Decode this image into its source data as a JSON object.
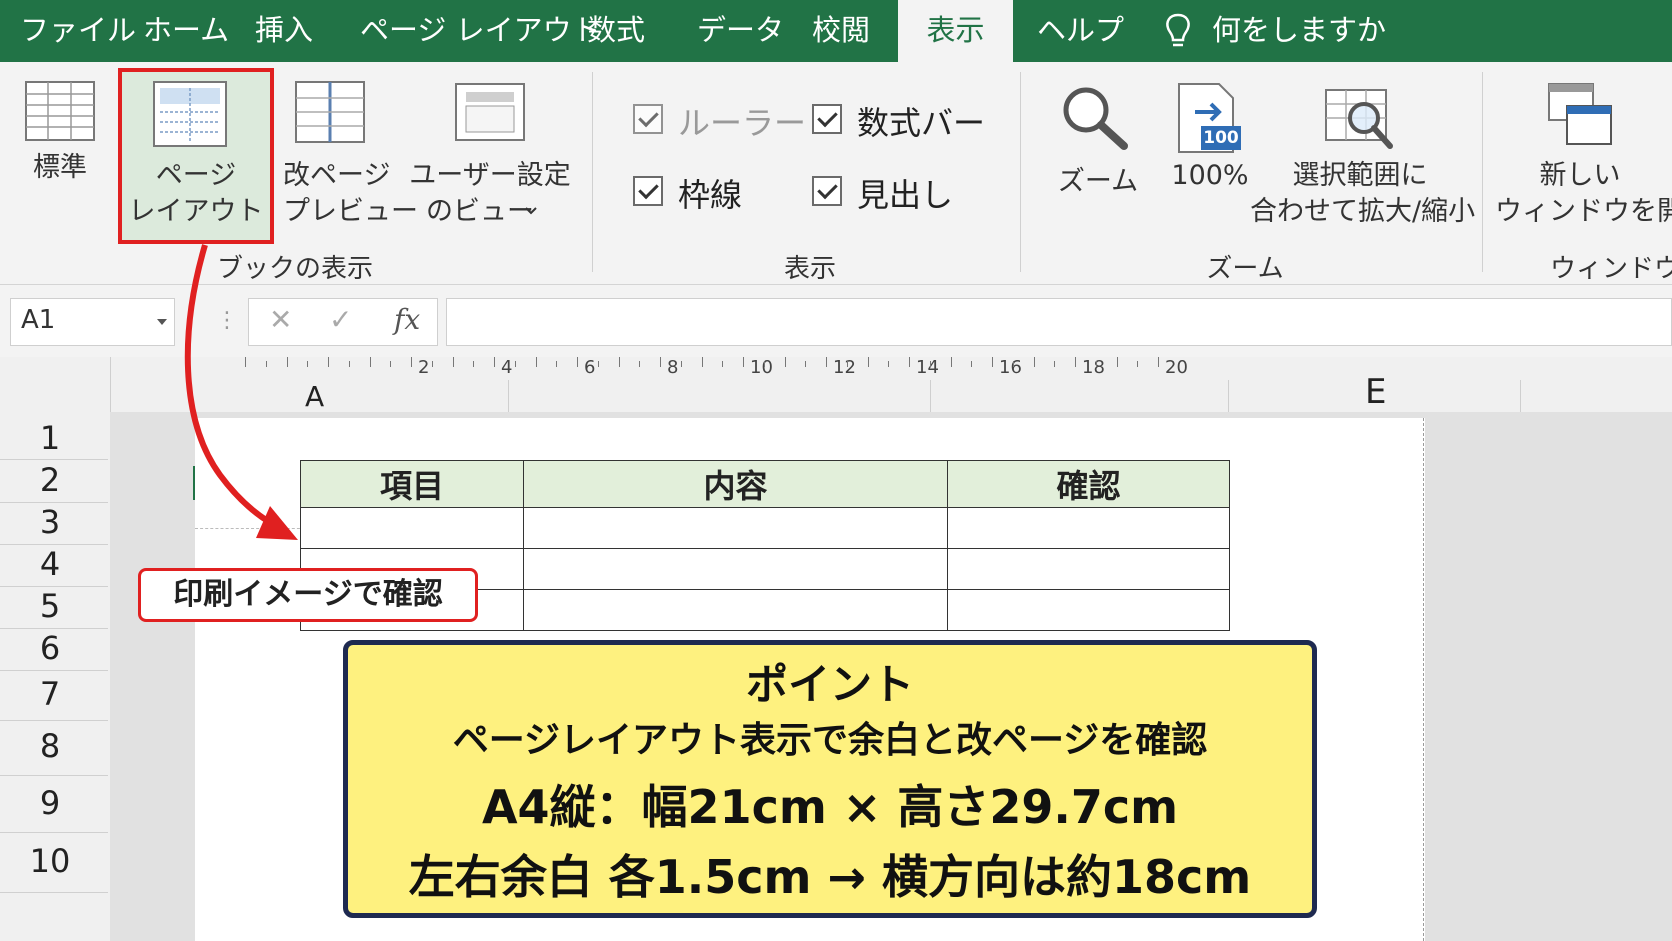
{
  "tabs": [
    "ファイル",
    "ホーム",
    "挿入",
    "ページ レイアウト",
    "数式",
    "データ",
    "校閲",
    "表示",
    "ヘルプ"
  ],
  "tell_me": "何をしますか",
  "ribbon": {
    "view_group": {
      "normal": "標準",
      "page_layout_1": "ページ",
      "page_layout_2": "レイアウト",
      "page_break_1": "改ページ",
      "page_break_2": "プレビュー",
      "custom_1": "ユーザー設定",
      "custom_2": "のビュー",
      "label": "ブックの表示"
    },
    "show_group": {
      "ruler": "ルーラー",
      "formula_bar": "数式バー",
      "gridlines": "枠線",
      "headings": "見出し",
      "label": "表示"
    },
    "zoom_group": {
      "zoom": "ズーム",
      "hundred": "100%",
      "hundred_badge": "100",
      "fit_1": "選択範囲に",
      "fit_2": "合わせて拡大/縮小",
      "label": "ズーム"
    },
    "window_group": {
      "new_1": "新しい",
      "new_2": "ウィンドウを開く",
      "label": "ウィンドウ"
    }
  },
  "name_box": "A1",
  "fx": "fx",
  "ruler_ticks": [
    "2",
    "4",
    "6",
    "8",
    "10",
    "12",
    "14",
    "16",
    "18",
    "20"
  ],
  "col_a": "A",
  "col_e": "E",
  "rows": [
    "1",
    "2",
    "3",
    "4",
    "5",
    "6",
    "7",
    "8",
    "9",
    "10"
  ],
  "table": {
    "headers": [
      "項目",
      "内容",
      "確認"
    ]
  },
  "callout": "印刷イメージで確認",
  "point": {
    "title": "ポイント",
    "line1": "ページレイアウト表示で余白と改ページを確認",
    "line2": "A4縦：幅21cm × 高さ29.7cm",
    "line3": "左右余白 各1.5cm → 横方向は約18cm"
  },
  "colors": {
    "excel_green": "#217346",
    "highlight_red": "#e02020",
    "header_fill": "#e2efda",
    "point_fill": "#fef17f",
    "point_border": "#1e2a50"
  }
}
